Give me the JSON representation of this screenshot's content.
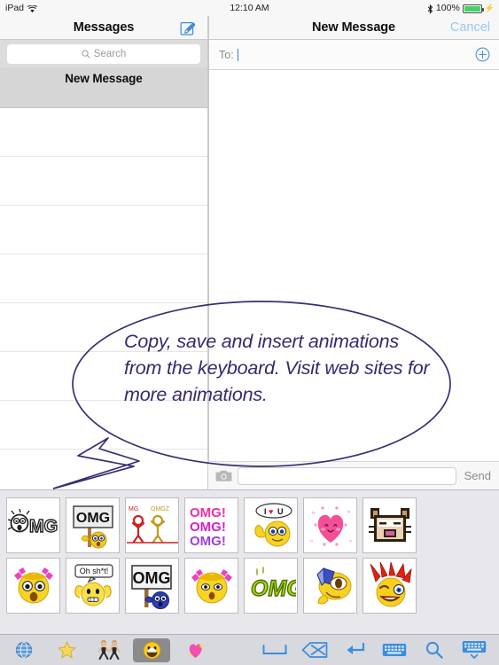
{
  "status_bar": {
    "device": "iPad",
    "wifi_icon": "wifi-icon",
    "time": "12:10 AM",
    "bluetooth_icon": "bluetooth-icon",
    "battery_percent": "100%",
    "battery_icon": "battery-icon",
    "charging_icon": "charging-bolt-icon",
    "battery_color": "#45d264"
  },
  "sidebar": {
    "title": "Messages",
    "compose_icon": "compose-icon",
    "search": {
      "placeholder": "Search",
      "icon": "search-icon",
      "value": ""
    },
    "threads": [
      {
        "label": "New Message",
        "selected": true
      }
    ],
    "empty_row_count": 7
  },
  "conversation": {
    "title": "New Message",
    "cancel_label": "Cancel",
    "cancel_color": "#9cc8f0",
    "to_field": {
      "label": "To:",
      "value": "",
      "caret_color": "#2f7fe0"
    },
    "add_contact_icon": "add-contact-icon",
    "input_bar": {
      "camera_icon": "camera-icon",
      "message_value": "",
      "send_label": "Send",
      "send_color": "#8c8c8c"
    }
  },
  "callout": {
    "text": "Copy, save and insert animations from the keyboard. Visit web sites for more animations.",
    "color": "#342a6e"
  },
  "sticker_panel": {
    "background": "#e8e8ec",
    "rows": [
      [
        {
          "name": "omg-shocked-face-bw",
          "label": "OMG"
        },
        {
          "name": "omg-sign-emoji",
          "label": "OMG"
        },
        {
          "name": "omg-stick-figures",
          "label": "OMG OMGZ"
        },
        {
          "name": "omg-pink-text-triple",
          "label": "OMG! OMG! OMG!"
        },
        {
          "name": "i-love-u-smiley",
          "label": "I ♥ U"
        },
        {
          "name": "pink-kawaii-heart",
          "label": ""
        },
        {
          "name": "pixel-cat-face",
          "label": ""
        }
      ],
      [
        {
          "name": "pigtails-shocked-smiley",
          "label": ""
        },
        {
          "name": "oh-shoot-smiley",
          "label": "Oh sh*t!"
        },
        {
          "name": "omg-sign-blue-emoji",
          "label": "OMG"
        },
        {
          "name": "pigtails-surprised-smiley",
          "label": ""
        },
        {
          "name": "omg-green-text",
          "label": "OMG!"
        },
        {
          "name": "yellow-rolling-smiley",
          "label": ""
        },
        {
          "name": "red-mohawk-winking-smiley",
          "label": ""
        }
      ]
    ]
  },
  "keyboard_toolbar": {
    "background": "#d7d9de",
    "tabs": [
      {
        "name": "globe-icon",
        "glyph": "🌐",
        "selected": false
      },
      {
        "name": "star-favorites-icon",
        "glyph": "⭐",
        "selected": false
      },
      {
        "name": "dancers-icon",
        "glyph": "👯",
        "selected": false
      },
      {
        "name": "smiley-icon",
        "glyph": "😀",
        "selected": true
      },
      {
        "name": "sparkling-heart-icon",
        "glyph": "💖",
        "selected": false
      }
    ],
    "actions": [
      {
        "name": "space-bar-button"
      },
      {
        "name": "backspace-delete-button"
      },
      {
        "name": "return-key-button"
      },
      {
        "name": "keyboard-button"
      },
      {
        "name": "search-button"
      },
      {
        "name": "hide-keyboard-button"
      }
    ],
    "icon_color": "#3c8dde"
  }
}
